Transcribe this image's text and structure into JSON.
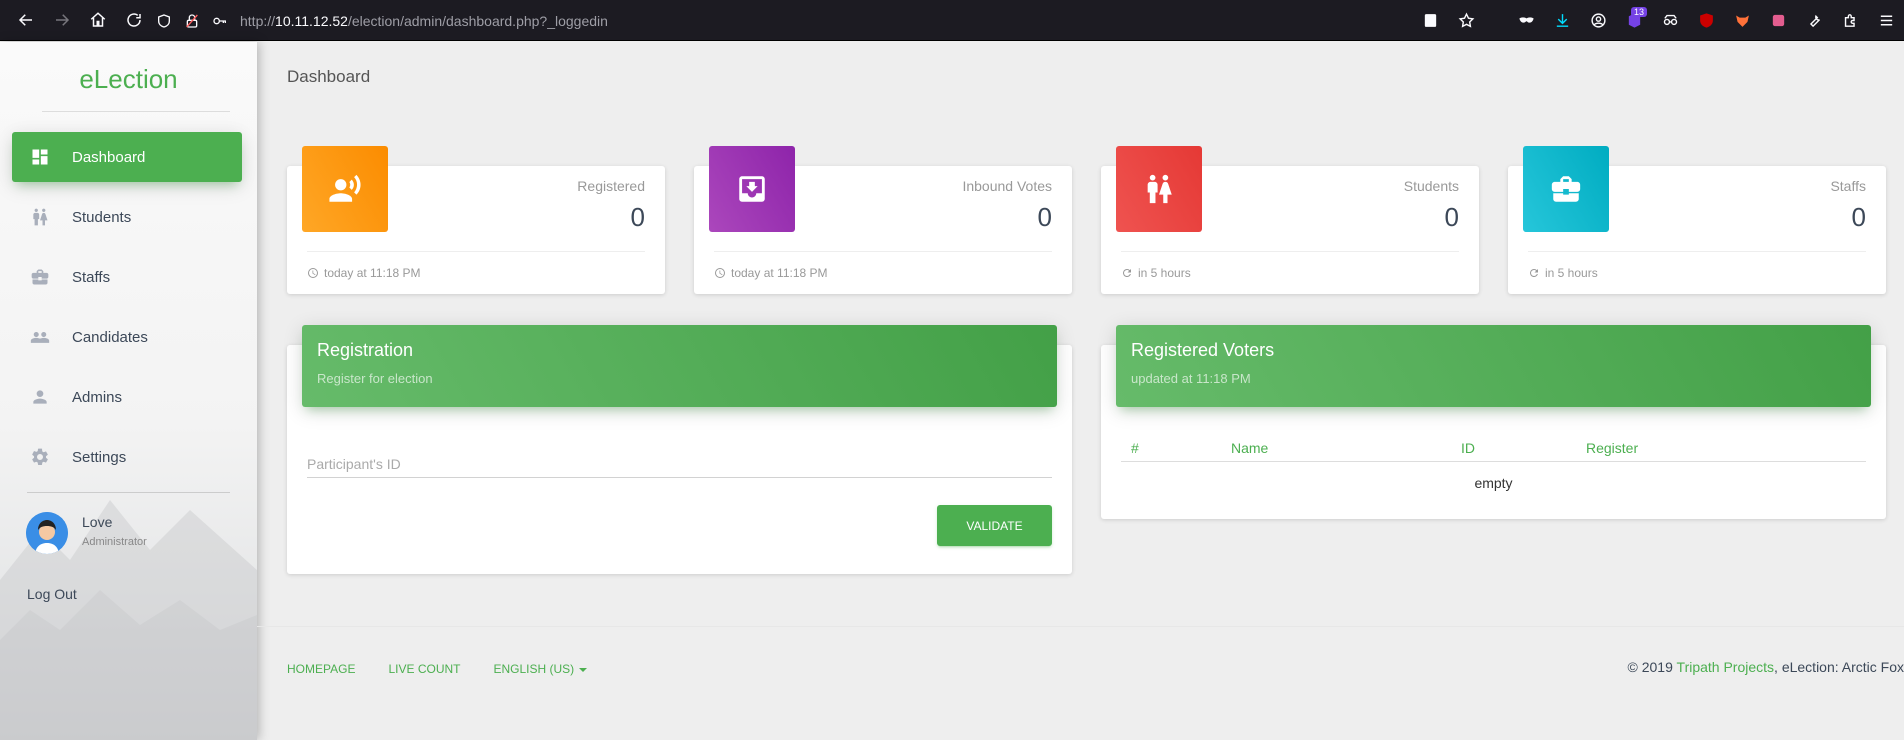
{
  "browser": {
    "url_prefix": "http://",
    "url_host": "10.11.12.52",
    "url_path": "/election/admin/dashboard.php?_loggedin",
    "badge_count": "13"
  },
  "sidebar": {
    "brand": "eLection",
    "items": [
      {
        "label": "Dashboard",
        "icon": "dashboard-icon",
        "active": true
      },
      {
        "label": "Students",
        "icon": "students-icon"
      },
      {
        "label": "Staffs",
        "icon": "briefcase-icon"
      },
      {
        "label": "Candidates",
        "icon": "people-icon"
      },
      {
        "label": "Admins",
        "icon": "person-icon"
      },
      {
        "label": "Settings",
        "icon": "gear-icon"
      }
    ],
    "user": {
      "name": "Love",
      "role": "Administrator"
    },
    "logout": "Log Out"
  },
  "page": {
    "title": "Dashboard"
  },
  "stats": [
    {
      "category": "Registered",
      "value": "0",
      "footer": "today at 11:18 PM",
      "color": "#ff9800",
      "icon": "voice-icon",
      "footer_icon": "clock-icon"
    },
    {
      "category": "Inbound Votes",
      "value": "0",
      "footer": "today at 11:18 PM",
      "color": "#9c27b0",
      "icon": "inbox-icon",
      "footer_icon": "clock-icon"
    },
    {
      "category": "Students",
      "value": "0",
      "footer": "in 5 hours",
      "color": "#e53935",
      "icon": "wc-icon",
      "footer_icon": "refresh-icon"
    },
    {
      "category": "Staffs",
      "value": "0",
      "footer": "in 5 hours",
      "color": "#00acc1",
      "icon": "briefcase-icon",
      "footer_icon": "refresh-icon"
    }
  ],
  "registration": {
    "title": "Registration",
    "subtitle": "Register for election",
    "input_placeholder": "Participant's ID",
    "button": "VALIDATE"
  },
  "voters": {
    "title": "Registered Voters",
    "subtitle": "updated at 11:18 PM",
    "columns": [
      "#",
      "Name",
      "ID",
      "Register"
    ],
    "empty": "empty"
  },
  "footer": {
    "links": [
      "HOMEPAGE",
      "LIVE COUNT",
      "ENGLISH (US)"
    ],
    "copyright_prefix": "© 2019 ",
    "copyright_link": "Tripath Projects",
    "copyright_suffix": ", eLection: Arctic Fox"
  },
  "colors": {
    "accent": "#4caf50"
  }
}
